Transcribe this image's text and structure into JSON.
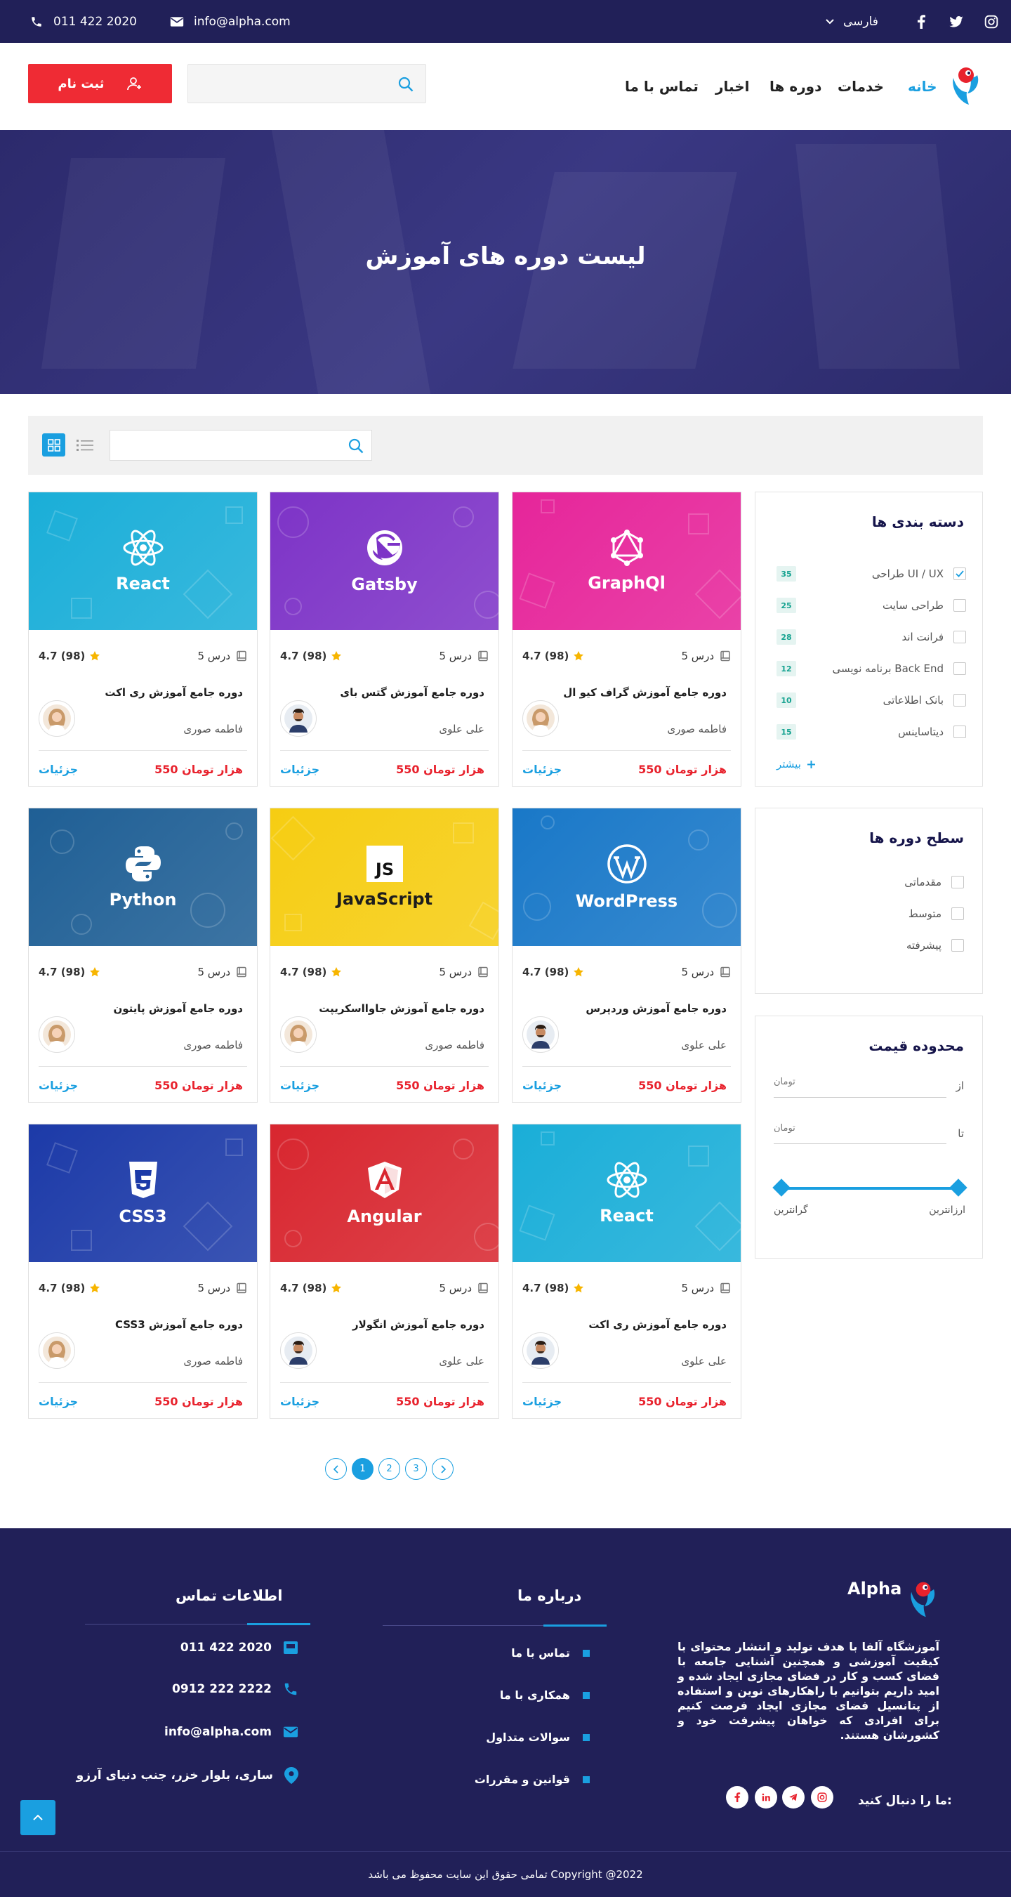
{
  "topbar": {
    "phone": "011 422 2020",
    "email": "info@alpha.com",
    "language": "فارسی"
  },
  "header": {
    "register_label": "ثبت نام",
    "search_placeholder": "",
    "nav": {
      "home": "خانه",
      "services": "خدمات",
      "courses": "دوره ها",
      "news": "اخبار",
      "contact": "تماس با ما"
    }
  },
  "hero": {
    "title": "لیست دوره های آموزش"
  },
  "filter": {
    "search_placeholder": ""
  },
  "sidebar": {
    "categories_title": "دسته بندی ها",
    "categories": [
      {
        "label": "طراحی UI / UX",
        "count": "35",
        "checked": true
      },
      {
        "label": "طراحی سایت",
        "count": "25",
        "checked": false
      },
      {
        "label": "فرانت اند",
        "count": "28",
        "checked": false
      },
      {
        "label": "برنامه نویسی Back End",
        "count": "12",
        "checked": false
      },
      {
        "label": "بانک اطلاعاتی",
        "count": "10",
        "checked": false
      },
      {
        "label": "دیتاساینس",
        "count": "15",
        "checked": false
      }
    ],
    "more_label": "بیشتر",
    "levels_title": "سطح دوره ها",
    "levels": [
      "مقدماتی",
      "متوسط",
      "پیشرفته"
    ],
    "price_title": "محدوده قیمت",
    "price_from_label": "از",
    "price_to_label": "تا",
    "price_unit": "تومان",
    "range_min_label": "ارزانترین",
    "range_max_label": "گرانترین"
  },
  "courses": [
    {
      "brand": "GraphQl",
      "lessons": "5 درس",
      "rating": "4.7 (98)",
      "title": "دوره جامع آموزش گراف کیو ال",
      "teacher": "فاطمه صوری",
      "price": "550 هزار تومان",
      "detail": "جزئیات",
      "bg": "#e6259a",
      "avatar": "female"
    },
    {
      "brand": "Gatsby",
      "lessons": "5 درس",
      "rating": "4.7 (98)",
      "title": "دوره جامع آموزش گتس بای",
      "teacher": "علی علوی",
      "price": "550 هزار تومان",
      "detail": "جزئیات",
      "bg": "#7d33c7",
      "avatar": "male"
    },
    {
      "brand": "React",
      "lessons": "5 درس",
      "rating": "4.7 (98)",
      "title": "دوره جامع آموزش ری اکت",
      "teacher": "فاطمه صوری",
      "price": "550 هزار تومان",
      "detail": "جزئیات",
      "bg": "#1aaed8",
      "avatar": "female"
    },
    {
      "brand": "WordPress",
      "lessons": "5 درس",
      "rating": "4.7 (98)",
      "title": "دوره جامع آموزش وردپرس",
      "teacher": "علی علوی",
      "price": "550 هزار تومان",
      "detail": "جزئیات",
      "bg": "#1978c8",
      "avatar": "male"
    },
    {
      "brand": "JavaScript",
      "lessons": "5 درس",
      "rating": "4.7 (98)",
      "title": "دوره جامع آموزش جاوااسکریپت",
      "teacher": "فاطمه صوری",
      "price": "550 هزار تومان",
      "detail": "جزئیات",
      "bg": "#f6cd12",
      "avatar": "female"
    },
    {
      "brand": "Python",
      "lessons": "5 درس",
      "rating": "4.7 (98)",
      "title": "دوره جامع آموزش پایتون",
      "teacher": "فاطمه صوری",
      "price": "550 هزار تومان",
      "detail": "جزئیات",
      "bg": "#1f5f95",
      "avatar": "female"
    },
    {
      "brand": "React",
      "lessons": "5 درس",
      "rating": "4.7 (98)",
      "title": "دوره جامع آموزش ری اکت",
      "teacher": "علی علوی",
      "price": "550 هزار تومان",
      "detail": "جزئیات",
      "bg": "#1aaed8",
      "avatar": "male"
    },
    {
      "brand": "Angular",
      "lessons": "5 درس",
      "rating": "4.7 (98)",
      "title": "دوره جامع آموزش انگولار",
      "teacher": "علی علوی",
      "price": "550 هزار تومان",
      "detail": "جزئیات",
      "bg": "#d8262f",
      "avatar": "male"
    },
    {
      "brand": "CSS3",
      "lessons": "5 درس",
      "rating": "4.7 (98)",
      "title": "دوره جامع آموزش CSS3",
      "teacher": "فاطمه صوری",
      "price": "550 هزار تومان",
      "detail": "جزئیات",
      "bg": "#1c3aa8",
      "avatar": "female"
    }
  ],
  "pagination": {
    "pages": [
      "1",
      "2",
      "3"
    ],
    "current": "1"
  },
  "footer": {
    "brand": "Alpha",
    "about": "آموزشگاه آلفا با هدف تولید و انتشار محتوای با کیفیت آموزشی و همچنین آشنایی جامعه با فضای کسب و کار در فضای مجازی ایجاد شده و امید داریم بتوانیم با راهکارهای نوین و استفاده از پتانسیل فضای مجازی ایجاد فرصت کنیم برای افرادی که خواهان پیشرفت خود و کشورشان هستند.",
    "follow_label": "ما را دنبال کنید:",
    "about_title": "درباره ما",
    "about_links": [
      "تماس با ما",
      "همکاری با ما",
      "سوالات متداول",
      "قوانین و مقررات"
    ],
    "contact_title": "اطلاعات تماس",
    "contact": {
      "phone": "011 422 2020",
      "mobile": "0912 222 2222",
      "email": "info@alpha.com",
      "address": "ساری، بلوار خزر، جنب دنیای آرزو"
    },
    "copyright": "تمامی حقوق این سایت محفوظ می باشد Copyright @2022"
  }
}
